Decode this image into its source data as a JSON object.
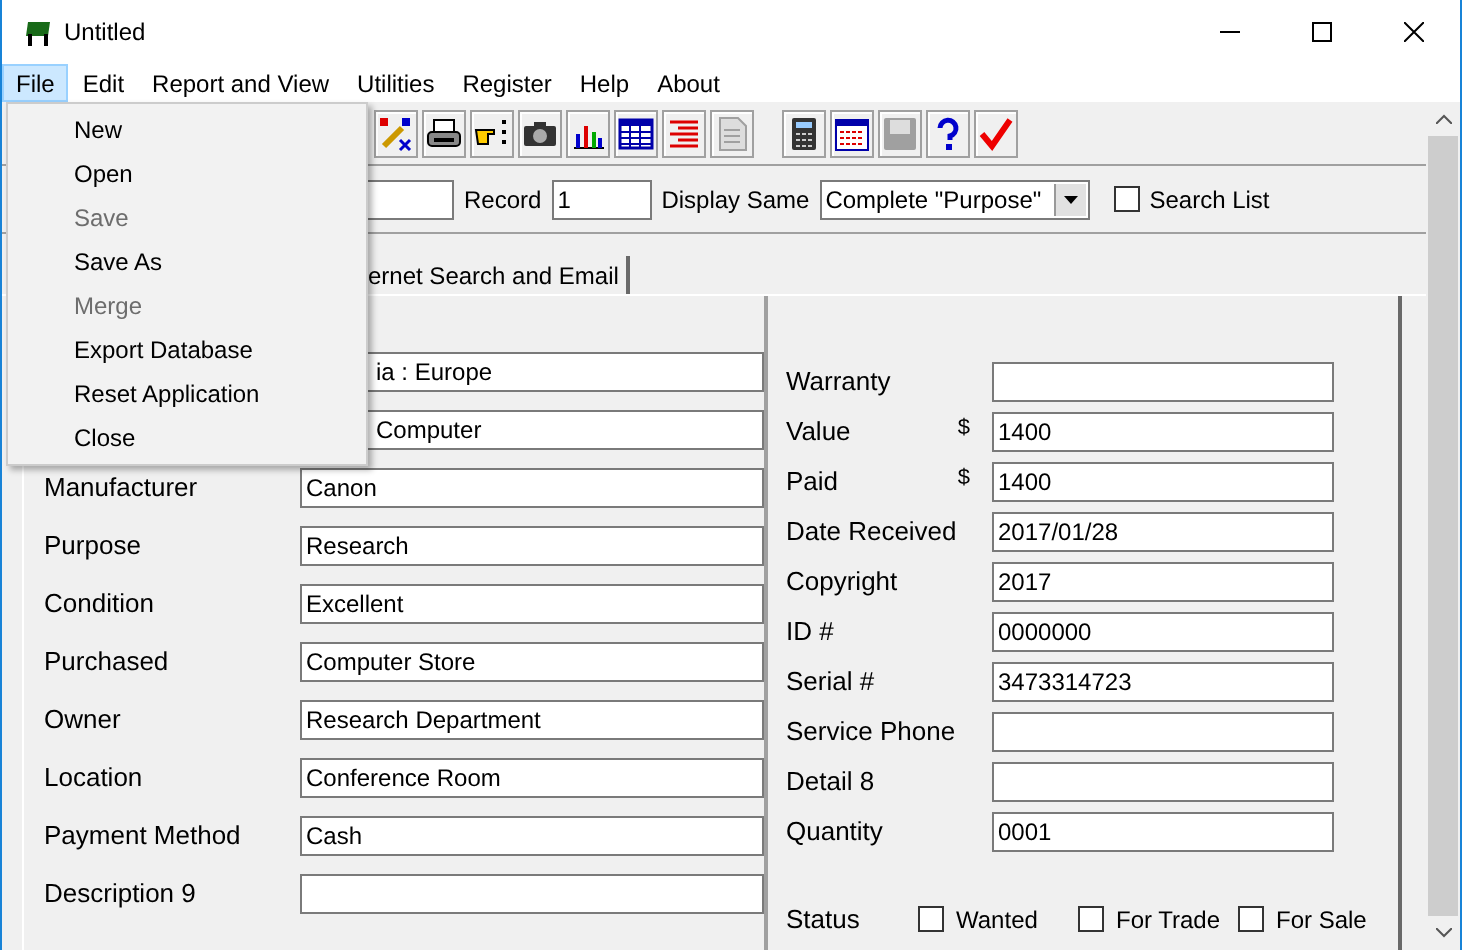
{
  "window": {
    "title": "Untitled"
  },
  "menu_bar": [
    {
      "label": "File",
      "selected": true
    },
    {
      "label": "Edit",
      "selected": false
    },
    {
      "label": "Report and View",
      "selected": false
    },
    {
      "label": "Utilities",
      "selected": false
    },
    {
      "label": "Register",
      "selected": false
    },
    {
      "label": "Help",
      "selected": false
    },
    {
      "label": "About",
      "selected": false
    }
  ],
  "file_menu": [
    {
      "label": "New",
      "disabled": false
    },
    {
      "label": "Open",
      "disabled": false
    },
    {
      "label": "Save",
      "disabled": true
    },
    {
      "label": "Save As",
      "disabled": false
    },
    {
      "label": "Merge",
      "disabled": true
    },
    {
      "label": "Export Database",
      "disabled": false
    },
    {
      "label": "Reset Application",
      "disabled": false
    },
    {
      "label": "Close",
      "disabled": false
    }
  ],
  "toolbar": [
    {
      "kind": "wand",
      "disabled": false
    },
    {
      "kind": "printer",
      "disabled": false
    },
    {
      "kind": "pointer",
      "disabled": false
    },
    {
      "kind": "camera",
      "disabled": false
    },
    {
      "kind": "chart",
      "disabled": false
    },
    {
      "kind": "table",
      "disabled": false
    },
    {
      "kind": "list",
      "disabled": false
    },
    {
      "kind": "document",
      "disabled": true
    },
    {
      "kind": "gap"
    },
    {
      "kind": "calculator",
      "disabled": false
    },
    {
      "kind": "calendar",
      "disabled": false
    },
    {
      "kind": "disk",
      "disabled": true
    },
    {
      "kind": "help",
      "disabled": false
    },
    {
      "kind": "check",
      "disabled": false
    }
  ],
  "record_bar": {
    "record_label": "Record",
    "record_value": "1",
    "display_label": "Display Same",
    "display_value": "Complete \"Purpose\"",
    "search_list": {
      "label": "Search List",
      "checked": false
    }
  },
  "tabs": [
    {
      "label": "ernet Search and Email",
      "selected": true
    }
  ],
  "left_fields": [
    {
      "value": "ia : Europe"
    },
    {
      "value": "Computer"
    },
    {
      "label": "Manufacturer",
      "value": "Canon"
    },
    {
      "label": "Purpose",
      "value": "Research"
    },
    {
      "label": "Condition",
      "value": "Excellent"
    },
    {
      "label": "Purchased",
      "value": "Computer Store"
    },
    {
      "label": "Owner",
      "value": "Research Department"
    },
    {
      "label": "Location",
      "value": "Conference Room"
    },
    {
      "label": "Payment Method",
      "value": "Cash"
    },
    {
      "label": "Description 9"
    }
  ],
  "right_fields": [
    {
      "label": "Warranty"
    },
    {
      "label": "Value",
      "prefix": "$",
      "value": "1400"
    },
    {
      "label": "Paid",
      "prefix": "$",
      "value": "1400"
    },
    {
      "label": "Date Received",
      "value": "2017/01/28"
    },
    {
      "label": "Copyright",
      "value": "2017"
    },
    {
      "label": "ID #",
      "value": "0000000"
    },
    {
      "label": "Serial #",
      "value": "3473314723"
    },
    {
      "label": "Service Phone"
    },
    {
      "label": "Detail 8"
    },
    {
      "label": "Quantity",
      "value": "0001"
    }
  ],
  "status": {
    "label": "Status",
    "options": [
      {
        "label": "Wanted",
        "checked": false
      },
      {
        "label": "For Trade",
        "checked": false
      },
      {
        "label": "For Sale",
        "checked": false
      }
    ]
  }
}
